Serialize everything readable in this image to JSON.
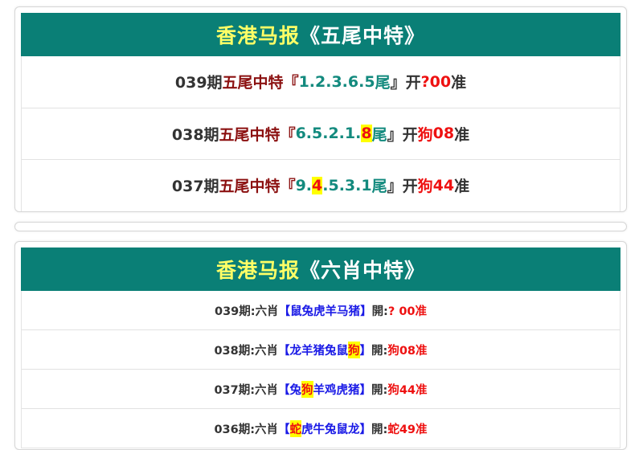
{
  "card1": {
    "title": "香港马报",
    "subtitle": "《五尾中特》",
    "rows": [
      {
        "period": "039期",
        "label": "五尾中特",
        "open": "『",
        "pre": "1.2.3.6.5",
        "hl": "",
        "post": "",
        "unit": "尾",
        "close": "』",
        "kai": "开",
        "zodiac": "?",
        "num": " 00",
        "zhun": "准"
      },
      {
        "period": "038期",
        "label": "五尾中特",
        "open": "『",
        "pre": "6.5.2.1.",
        "hl": "8",
        "post": "",
        "unit": "尾",
        "close": "』",
        "kai": "开",
        "zodiac": "狗",
        "num": "08",
        "zhun": "准"
      },
      {
        "period": "037期",
        "label": "五尾中特",
        "open": "『",
        "pre": "9.",
        "hl": "4",
        "post": ".5.3.1",
        "unit": "尾",
        "close": "』",
        "kai": "开",
        "zodiac": "狗",
        "num": "44",
        "zhun": "准"
      }
    ]
  },
  "card2": {
    "title": "香港马报",
    "subtitle": "《六肖中特》",
    "rows": [
      {
        "period": "039期:",
        "label": "六肖",
        "open": "【",
        "pre": "鼠兔虎羊马猪",
        "hl": "",
        "post": "",
        "close": "】",
        "kai": "開:",
        "result": "? 00准"
      },
      {
        "period": "038期:",
        "label": "六肖",
        "open": "【",
        "pre": "龙羊猪兔鼠",
        "hl": "狗",
        "post": "",
        "close": "】",
        "kai": "開:",
        "result": "狗08准"
      },
      {
        "period": "037期:",
        "label": "六肖",
        "open": "【",
        "pre": "兔",
        "hl": "狗",
        "post": "羊鸡虎猪",
        "close": "】",
        "kai": "開:",
        "result": "狗44准"
      },
      {
        "period": "036期:",
        "label": "六肖",
        "open": "【",
        "pre": "",
        "hl": "蛇",
        "post": "虎牛兔鼠龙",
        "close": "】",
        "kai": "開:",
        "result": "蛇49准"
      }
    ]
  },
  "colors": {
    "header_bg": "#0a7f76",
    "title_yellow": "#ffff66",
    "highlight": "#ffff00",
    "red": "#ee1111",
    "teal": "#138a7e",
    "maroon": "#8b1010",
    "blue": "#1a1ae6"
  }
}
